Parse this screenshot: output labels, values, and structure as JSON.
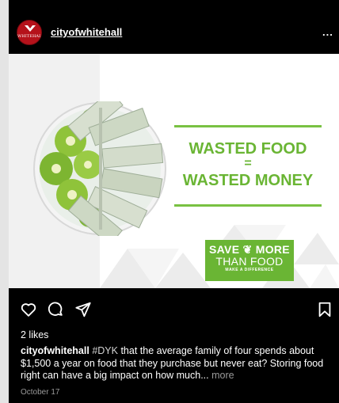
{
  "header": {
    "username": "cityofwhitehall",
    "avatar_text": "WHITEHALL",
    "more_icon": "more-horizontal-icon",
    "more_label": "..."
  },
  "post_image": {
    "headline_line1": "WASTED FOOD",
    "headline_equals": "=",
    "headline_line2": "WASTED MONEY",
    "badge_line1": "SAVE ❦ MORE",
    "badge_line2": "THAN FOOD",
    "badge_line3": "MAKE A DIFFERENCE",
    "accent_color": "#6ab534"
  },
  "actions": {
    "icons": [
      "heart-icon",
      "comment-icon",
      "share-icon",
      "bookmark-icon"
    ]
  },
  "likes": "2 likes",
  "caption": {
    "username": "cityofwhitehall",
    "hashtag": "#DYK",
    "text": " that the average family of four spends about $1,500 a year on food that they purchase but never eat? Storing food right can have a big impact on how much...",
    "more_label": "more"
  },
  "date": "October 17"
}
